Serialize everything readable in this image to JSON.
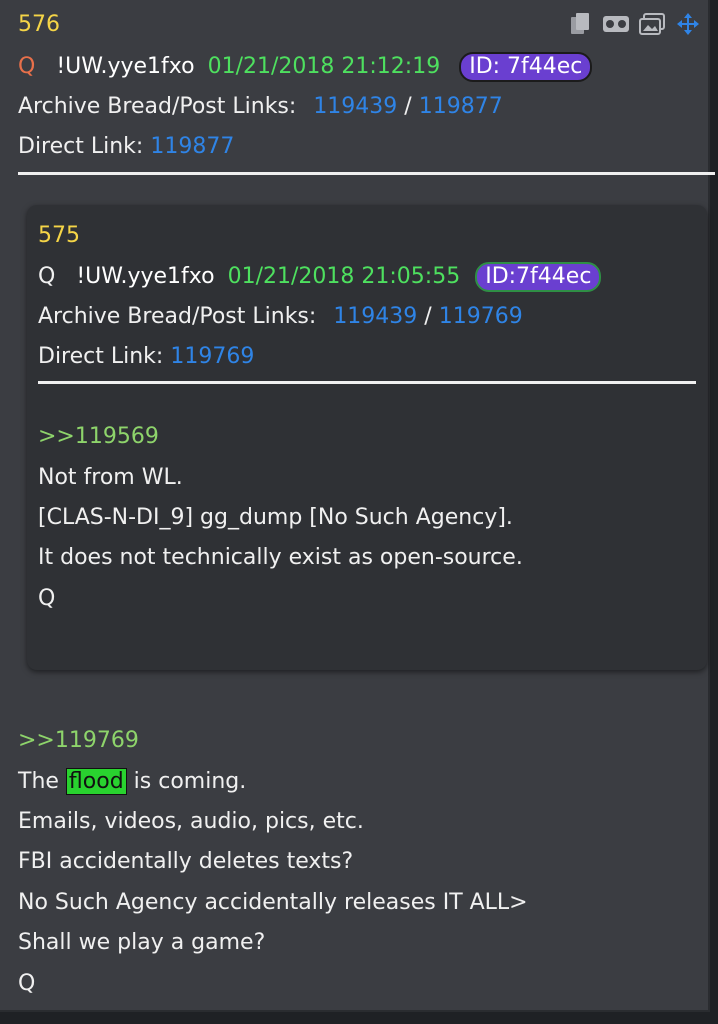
{
  "post": {
    "number": "576",
    "author": "Q",
    "tripcode": "!UW.yye1fxo",
    "datetime": "01/21/2018 21:12:19",
    "id_label": "ID: 7f44ec",
    "archive_label": "Archive Bread/Post Links:",
    "archive_link_1": "119439",
    "archive_sep": "/",
    "archive_link_2": "119877",
    "direct_label": "Direct Link:",
    "direct_link": "119877",
    "reply_ref": ">>119769",
    "body": {
      "line1_before": "The",
      "line1_highlight": "flood",
      "line1_after": "is coming.",
      "line2": "Emails, videos, audio, pics, etc.",
      "line3": "FBI accidentally deletes texts?",
      "line4": "No Such Agency accidentally releases IT ALL>",
      "line5": "Shall we play a game?",
      "line6": "Q"
    }
  },
  "quoted": {
    "number": "575",
    "author": "Q",
    "tripcode": "!UW.yye1fxo",
    "datetime": "01/21/2018 21:05:55",
    "id_label": "ID:7f44ec",
    "archive_label": "Archive Bread/Post Links:",
    "archive_link_1": "119439",
    "archive_sep": "/",
    "archive_link_2": "119769",
    "direct_label": "Direct Link:",
    "direct_link": "119769",
    "reply_ref": ">>119569",
    "body": {
      "line1": "Not from WL.",
      "line2": "[CLAS-N-DI_9] gg_dump [No Such Agency].",
      "line3": "It does not technically exist as open-source.",
      "line4": "Q"
    }
  },
  "icons": [
    "copy-icon",
    "vr-headset-icon",
    "gallery-icon",
    "move-icon"
  ],
  "colors": {
    "background": "#3b3d42",
    "number": "#f5d547",
    "date": "#4ee05f",
    "link": "#2f84e6",
    "id_badge": "#6a3fd0",
    "highlight": "#29d22f"
  }
}
